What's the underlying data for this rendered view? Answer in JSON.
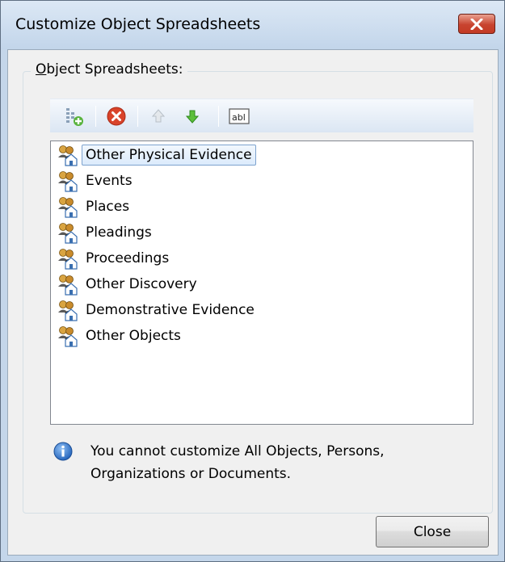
{
  "window": {
    "title": "Customize Object Spreadsheets",
    "close_glyph": "✕"
  },
  "group": {
    "label_access_key": "O",
    "label_rest": "bject Spreadsheets:"
  },
  "toolbar": {
    "buttons": [
      {
        "icon": "add-spreadsheet-icon"
      },
      {
        "icon": "delete-icon",
        "color": "#d9432a"
      },
      {
        "icon": "move-up-icon"
      },
      {
        "icon": "move-down-icon",
        "color": "#3fa22a"
      },
      {
        "icon": "rename-icon",
        "text": "abl"
      }
    ]
  },
  "list": {
    "items": [
      {
        "label": "Other Physical Evidence",
        "selected": true
      },
      {
        "label": "Events"
      },
      {
        "label": "Places"
      },
      {
        "label": "Pleadings"
      },
      {
        "label": "Proceedings"
      },
      {
        "label": "Other Discovery"
      },
      {
        "label": "Demonstrative Evidence"
      },
      {
        "label": "Other Objects"
      }
    ]
  },
  "info": {
    "line1": "You cannot customize All Objects, Persons,",
    "line2": "Organizations or Documents."
  },
  "footer": {
    "close_label": "Close"
  }
}
